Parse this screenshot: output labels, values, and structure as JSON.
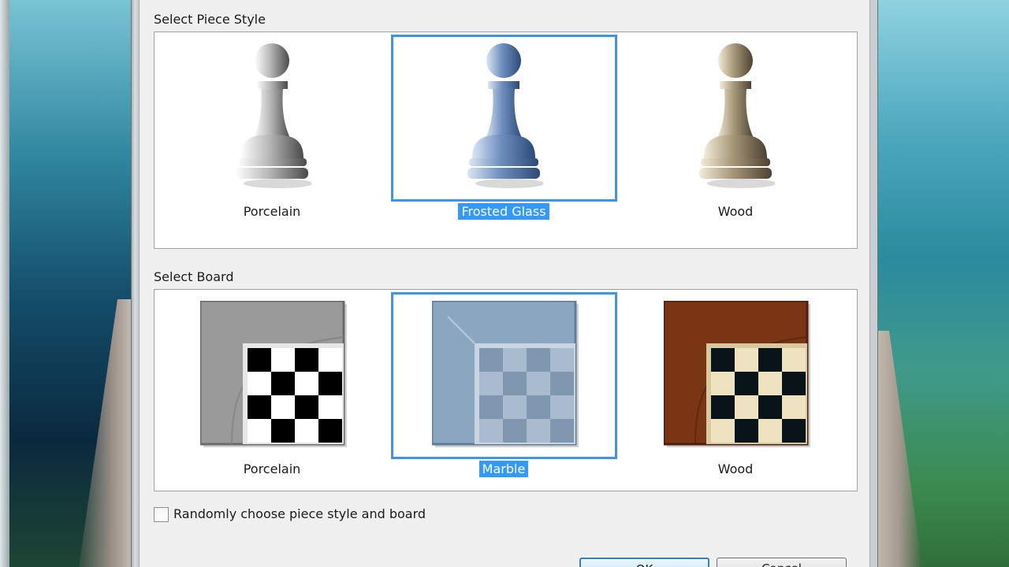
{
  "piece_style": {
    "label": "Select Piece Style",
    "options": [
      {
        "name": "Porcelain",
        "color": "#b8b8b8",
        "selected": false
      },
      {
        "name": "Frosted Glass",
        "color": "#6f8fbf",
        "selected": true
      },
      {
        "name": "Wood",
        "color": "#a8987a",
        "selected": false
      }
    ]
  },
  "board": {
    "label": "Select Board",
    "options": [
      {
        "name": "Porcelain",
        "frame_color": "#9a9a9a",
        "dark_square": "#000000",
        "light_square": "#ffffff",
        "selected": false
      },
      {
        "name": "Marble",
        "frame_color": "#8aa6c0",
        "dark_square": "#7f98b0",
        "light_square": "#a9bccf",
        "selected": true
      },
      {
        "name": "Wood",
        "frame_color": "#7a3515",
        "dark_square": "#08131a",
        "light_square": "#efe3bf",
        "selected": false
      }
    ]
  },
  "random_checkbox": {
    "label": "Randomly choose piece style and board",
    "checked": false
  },
  "buttons": {
    "ok_label": "OK",
    "cancel_label": "Cancel"
  },
  "accent_color": "#3399ff"
}
